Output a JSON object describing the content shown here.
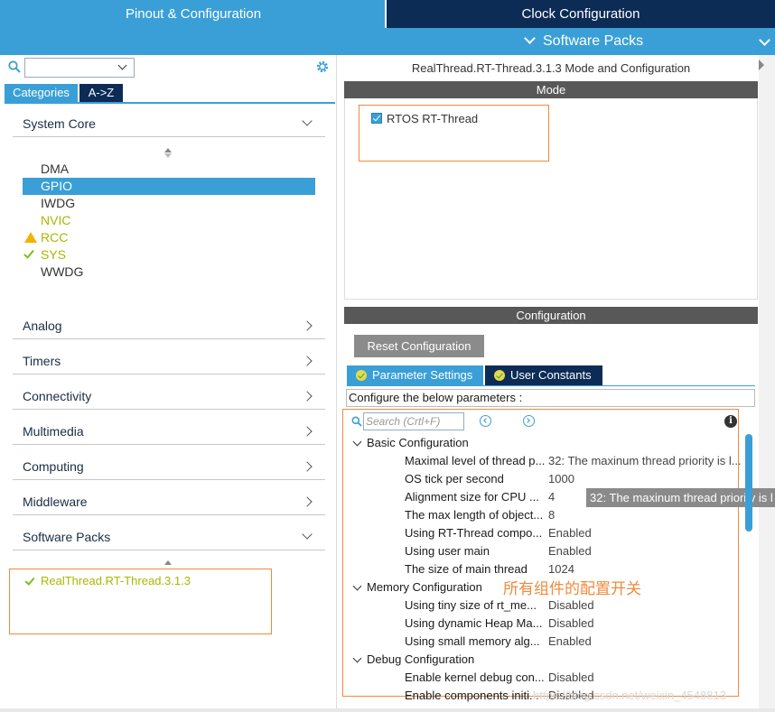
{
  "top_tabs": {
    "pinout": "Pinout & Configuration",
    "clock": "Clock Configuration"
  },
  "software_packs_bar": "Software Packs",
  "left": {
    "tabs": {
      "categories": "Categories",
      "az": "A->Z"
    },
    "system_core": {
      "label": "System Core",
      "items": [
        {
          "label": "DMA",
          "state": "normal"
        },
        {
          "label": "GPIO",
          "state": "selected"
        },
        {
          "label": "IWDG",
          "state": "normal"
        },
        {
          "label": "NVIC",
          "state": "green"
        },
        {
          "label": "RCC",
          "state": "warning"
        },
        {
          "label": "SYS",
          "state": "ok"
        },
        {
          "label": "WWDG",
          "state": "normal"
        }
      ]
    },
    "categories": [
      "Analog",
      "Timers",
      "Connectivity",
      "Multimedia",
      "Computing",
      "Middleware",
      "Software Packs"
    ],
    "software_pack_item": "RealThread.RT-Thread.3.1.3"
  },
  "mode": {
    "title": "RealThread.RT-Thread.3.1.3 Mode and Configuration",
    "bar": "Mode",
    "checkbox_label": "RTOS RT-Thread",
    "checkbox_checked": true
  },
  "configuration": {
    "bar": "Configuration",
    "reset_button": "Reset Configuration",
    "tabs": {
      "params": "Parameter Settings",
      "user": "User Constants"
    },
    "hint": "Configure the below parameters :",
    "search_placeholder": "Search (Crtl+F)",
    "info": "i",
    "groups": [
      {
        "name": "Basic Configuration",
        "params": [
          {
            "name": "Maximal level of thread p...",
            "value": "32: The maxinum thread priority is l..."
          },
          {
            "name": "OS tick per second",
            "value": "1000"
          },
          {
            "name": "Alignment size for CPU ...",
            "value": "4"
          },
          {
            "name": "The max length of object...",
            "value": "8"
          },
          {
            "name": "Using RT-Thread compo...",
            "value": "Enabled"
          },
          {
            "name": "Using user main",
            "value": "Enabled"
          },
          {
            "name": "The size of main thread",
            "value": "1024"
          }
        ]
      },
      {
        "name": "Memory Configuration",
        "params": [
          {
            "name": "Using tiny size of rt_me...",
            "value": "Disabled"
          },
          {
            "name": "Using dynamic Heap Ma...",
            "value": "Disabled"
          },
          {
            "name": "Using small memory alg...",
            "value": "Enabled"
          }
        ]
      },
      {
        "name": "Debug Configuration",
        "params": [
          {
            "name": "Enable kernel debug con...",
            "value": "Disabled"
          },
          {
            "name": "Enable components initi...",
            "value": "Disabled"
          }
        ]
      }
    ],
    "tooltip": "32: The maxinum thread priority is l",
    "annotation": "所有组件的配置开关",
    "watermark": "https://blog.csdn.net/weixin_4548813"
  },
  "colors": {
    "accent": "#3a9fd6",
    "dark_navy": "#0c2c56",
    "highlight_box": "#f08a3c",
    "ok_green": "#7bbf1f",
    "warning_yellow": "#f0b400"
  }
}
